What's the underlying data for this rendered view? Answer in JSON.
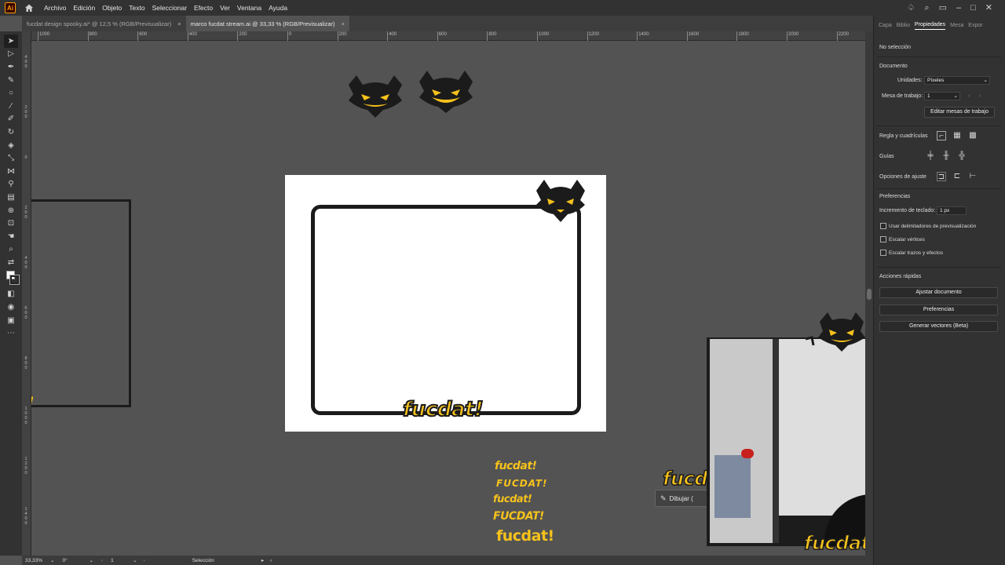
{
  "menubar": {
    "app_logo": "Ai",
    "items": [
      "Archivo",
      "Edición",
      "Objeto",
      "Texto",
      "Seleccionar",
      "Efecto",
      "Ver",
      "Ventana",
      "Ayuda"
    ],
    "right_icons": [
      "lightbulb-icon",
      "search-icon",
      "arrange-icon",
      "minimize-icon",
      "maximize-icon",
      "close-icon"
    ]
  },
  "tabs": [
    {
      "label": "fucdat design spooky.ai* @ 12,5 % (RGB/Previsualizar)",
      "close": "×"
    },
    {
      "label": "marco fucdat stream.ai @ 33,33 % (RGB/Previsualizar)",
      "close": "×"
    }
  ],
  "ruler": {
    "h_labels": [
      "1000",
      "800",
      "600",
      "400",
      "200",
      "0",
      "200",
      "400",
      "600",
      "800",
      "1000",
      "1200",
      "1400",
      "1600",
      "1800",
      "2000",
      "2200"
    ],
    "v_labels": [
      "400",
      "200",
      "0",
      "200",
      "400",
      "600",
      "800",
      "1000",
      "1200",
      "1400"
    ]
  },
  "tools": [
    "selection-tool",
    "direct-selection-tool",
    "pen-tool",
    "curvature-tool",
    "ellipse-tool",
    "paintbrush-tool",
    "shaper-tool",
    "rotate-tool",
    "eraser-tool",
    "scale-tool",
    "width-tool",
    "eyedropper-tool",
    "gradient-tool",
    "shape-builder-tool",
    "artboard-tool",
    "hand-tool",
    "zoom-tool"
  ],
  "statusbar": {
    "zoom": "33,33%",
    "rotation": "0°",
    "artboard": "1",
    "mode": "Selección"
  },
  "panel": {
    "tabs": [
      "Capa",
      "Biblio",
      "Propiedades",
      "Mesa",
      "Expor"
    ],
    "active_tab": "Propiedades",
    "no_selection": "No selección",
    "document_heading": "Documento",
    "units_label": "Unidades:",
    "units_value": "Píxeles",
    "artboard_label": "Mesa de trabajo:",
    "artboard_value": "1",
    "edit_artboards": "Editar mesas de trabajo",
    "ruler_grid_label": "Regla y cuadrículas",
    "guides_label": "Guías",
    "snap_label": "Opciones de ajuste",
    "preferences_heading": "Preferencias",
    "keyboard_increment_label": "Incremento de teclado:",
    "keyboard_increment_value": "1 px",
    "checkboxes": [
      "Usar delimitadores de previsualización",
      "Escalar vértices",
      "Escalar trazos y efectos"
    ],
    "quick_actions_heading": "Acciones rápidas",
    "buttons": [
      "Ajustar documento",
      "Preferencias",
      "Generar vectores (Beta)"
    ]
  },
  "artwork": {
    "logo_text": "fucdat!",
    "logo_variants": [
      "fucdat!",
      "FUCDAT!",
      "fucdat!",
      "FUCDAT!",
      "fucdat!"
    ],
    "draw_tooltip": "Dibujar (",
    "accent_color": "#f6c21c",
    "cat_color": "#1b1b1b"
  }
}
